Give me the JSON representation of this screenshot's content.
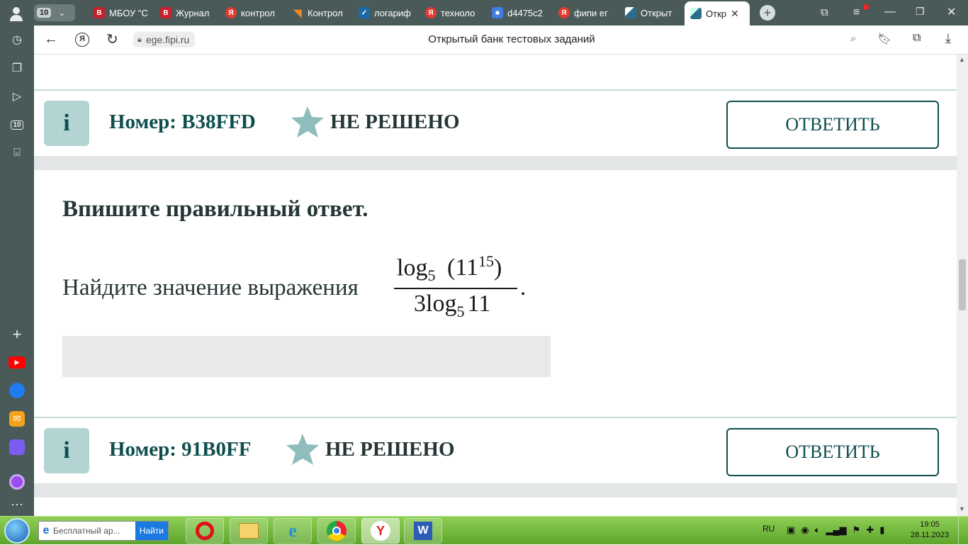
{
  "browser": {
    "tab_counter": "10",
    "tabs": [
      {
        "label": "МБОУ \"С",
        "icon": "red-square-icon"
      },
      {
        "label": "Журнал",
        "icon": "red-square-icon"
      },
      {
        "label": "контрол",
        "icon": "yandex-icon"
      },
      {
        "label": "Контрол",
        "icon": "orange-triangle-icon"
      },
      {
        "label": "логариф",
        "icon": "check-icon"
      },
      {
        "label": "техноло",
        "icon": "yandex-icon"
      },
      {
        "label": "d4475c2",
        "icon": "cube-icon"
      },
      {
        "label": "фипи ег",
        "icon": "yandex-icon"
      },
      {
        "label": "Открыт",
        "icon": "fipi-icon"
      },
      {
        "label": "Откр",
        "icon": "fipi-icon",
        "active": true
      }
    ],
    "url": "ege.fipi.ru",
    "page_title": "Открытый банк тестовых заданий",
    "sidebar_badge": "10"
  },
  "tasks": [
    {
      "info_label": "i",
      "number": "Номер: B38FFD",
      "status": "НЕ РЕШЕНО",
      "answer_label": "ОТВЕТИТЬ"
    },
    {
      "info_label": "i",
      "number": "Номер: 91B0FF",
      "status": "НЕ РЕШЕНО",
      "answer_label": "ОТВЕТИТЬ"
    }
  ],
  "problem": {
    "heading": "Впишите правильный ответ.",
    "text": "Найдите значение выражения",
    "formula": {
      "num_log": "log",
      "num_base": "5",
      "num_arg": "(11",
      "num_exp": "15",
      "num_close": ")",
      "den_coef": "3",
      "den_log": "log",
      "den_base": "5",
      "den_arg": "11",
      "end": "."
    }
  },
  "taskbar": {
    "search_text": "Бесплатный ар...",
    "search_button": "Найти",
    "lang": "RU",
    "time": "19:05",
    "date": "28.11.2023"
  },
  "colors": {
    "accent": "#0f4e4e",
    "info_bg": "#b4d4d4",
    "tab_bar": "#4a5a58"
  }
}
